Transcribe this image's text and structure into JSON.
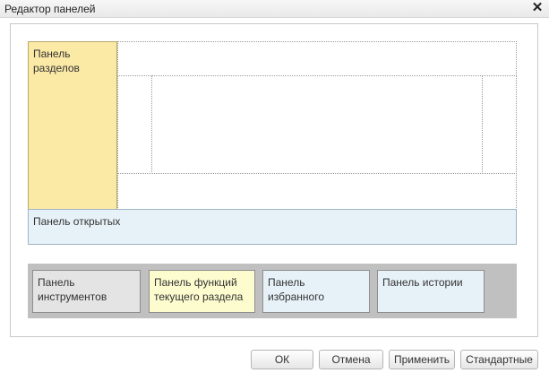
{
  "window": {
    "title": "Редактор панелей",
    "close_symbol": "✕"
  },
  "layout": {
    "sections_panel": "Панель\nразделов",
    "opened_panel": "Панель открытых"
  },
  "tray": {
    "panels": [
      {
        "label": "Панель\nинструментов",
        "color": "#e4e4e4"
      },
      {
        "label": "Панель функций\nтекущего раздела",
        "color": "#fdfccf"
      },
      {
        "label": "Панель\nизбранного",
        "color": "#e7f2f8"
      },
      {
        "label": "Панель истории",
        "color": "#e7f2f8"
      }
    ]
  },
  "buttons": {
    "ok": "ОК",
    "cancel": "Отмена",
    "apply": "Применить",
    "default": "Стандартные"
  }
}
